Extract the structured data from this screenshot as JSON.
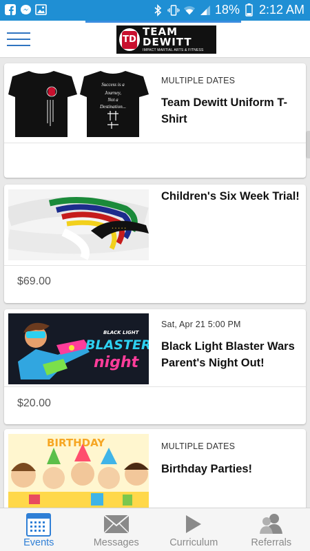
{
  "status_bar": {
    "battery": "18%",
    "time": "2:12 AM"
  },
  "header": {
    "logo_title_top": "TEAM",
    "logo_title_bottom": "DEWITT",
    "logo_subtitle": "IMPACT MARTIAL ARTS & FITNESS",
    "logo_mark": "TD"
  },
  "events": [
    {
      "meta": "MULTIPLE DATES",
      "title": "Team Dewitt Uniform T-Shirt",
      "price": "",
      "shirt_back_text": "Success is a Journey, Not a Destination..."
    },
    {
      "meta": "",
      "title": "Children's Six Week Trial!",
      "price": "$69.00"
    },
    {
      "meta": "Sat, Apr 21 5:00 PM",
      "title": "Black Light Blaster Wars Parent's Night Out!",
      "price": "$20.00",
      "image_text_top": "BLACK LIGHT",
      "image_text_main": "BLASTER",
      "image_text_bottom": "night"
    },
    {
      "meta": "MULTIPLE DATES",
      "title": "Birthday Parties!",
      "price": "",
      "image_banner": "BIRTHDAY"
    }
  ],
  "bottom_nav": [
    {
      "label": "Events",
      "icon": "calendar-icon",
      "active": true
    },
    {
      "label": "Messages",
      "icon": "envelope-icon",
      "active": false
    },
    {
      "label": "Curriculum",
      "icon": "play-icon",
      "active": false
    },
    {
      "label": "Referrals",
      "icon": "people-icon",
      "active": false
    }
  ],
  "colors": {
    "status_bar": "#1f8fd4",
    "accent": "#2f7fd6",
    "inactive": "#8a8a8a"
  }
}
